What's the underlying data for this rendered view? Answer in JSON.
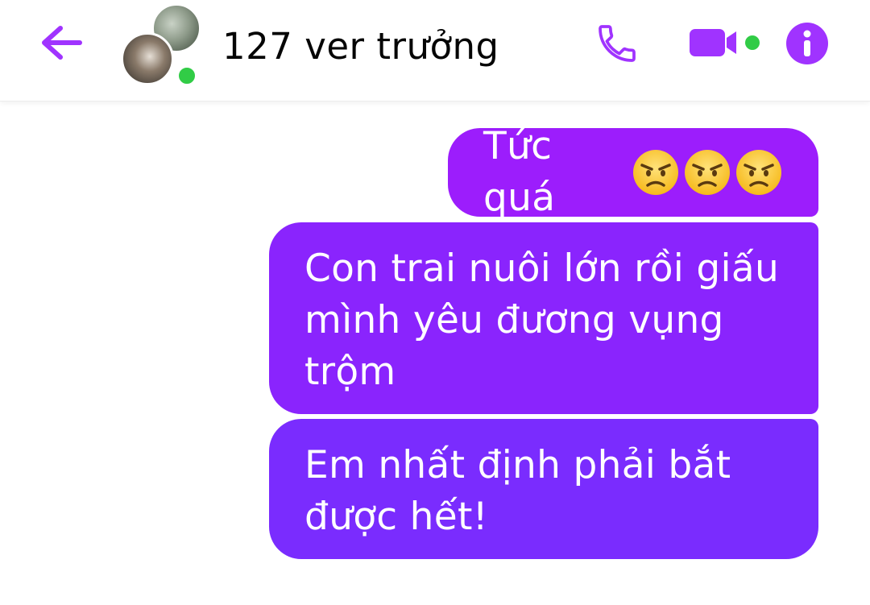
{
  "header": {
    "back_icon": "arrow-left-icon",
    "title": "127 ver trưởng",
    "status": "online",
    "actions": [
      {
        "name": "voice-call",
        "icon": "phone-icon"
      },
      {
        "name": "video-call",
        "icon": "video-camera-icon"
      },
      {
        "name": "info",
        "icon": "info-icon"
      }
    ]
  },
  "messages": [
    {
      "sender": "me",
      "text": "Tức quá",
      "emojis": [
        "angry-face",
        "angry-face",
        "angry-face"
      ]
    },
    {
      "sender": "me",
      "lines": [
        "Con trai nuôi lớn rồi giấu",
        "mình yêu đương vụng",
        "trộm"
      ]
    },
    {
      "sender": "me",
      "lines": [
        "Em nhất định phải bắt",
        "được hết!"
      ]
    }
  ],
  "colors": {
    "accent": "#a033ff",
    "presence": "#31cc46",
    "bubble_top": "#9c1dfc",
    "bubble_mid": "#8a24fd",
    "bubble_bottom": "#7a2cfe"
  }
}
